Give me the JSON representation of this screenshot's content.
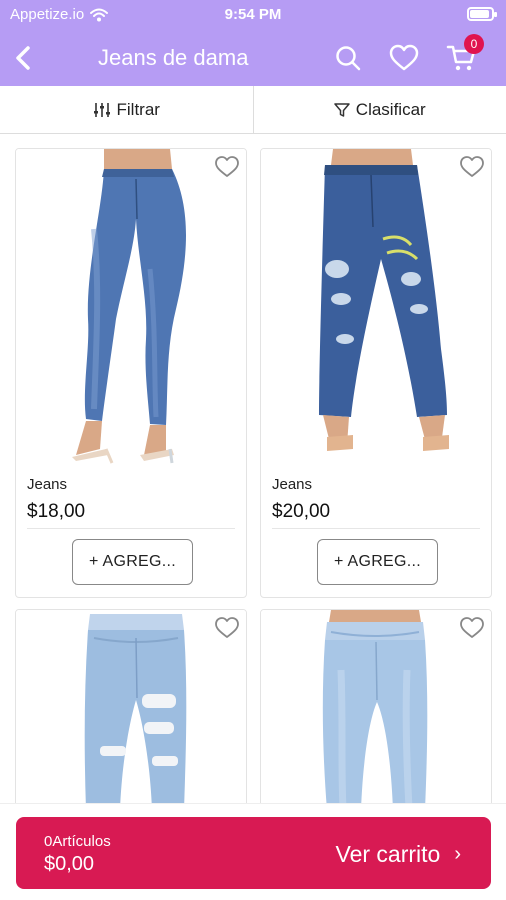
{
  "status_bar": {
    "carrier": "Appetize.io",
    "time": "9:54 PM",
    "battery_level": 0.9
  },
  "nav": {
    "title": "Jeans de dama",
    "cart_count": "0"
  },
  "filters": {
    "filter_label": "Filtrar",
    "sort_label": "Clasificar"
  },
  "products": [
    {
      "name": "Jeans",
      "price": "$18,00",
      "add_label": "+ AGREG..."
    },
    {
      "name": "Jeans",
      "price": "$20,00",
      "add_label": "+ AGREG..."
    },
    {
      "name": "",
      "price": "",
      "add_label": ""
    },
    {
      "name": "",
      "price": "",
      "add_label": ""
    }
  ],
  "cart_bar": {
    "count_label": "0Artículos",
    "total": "$0,00",
    "cta_label": "Ver carrito",
    "chevron": "›"
  },
  "colors": {
    "header": "#b69cf4",
    "cart_bar": "#d81a53",
    "badge": "#e0134f",
    "denim_dark": "#3b5f9c",
    "denim_light": "#a8c6e6"
  }
}
